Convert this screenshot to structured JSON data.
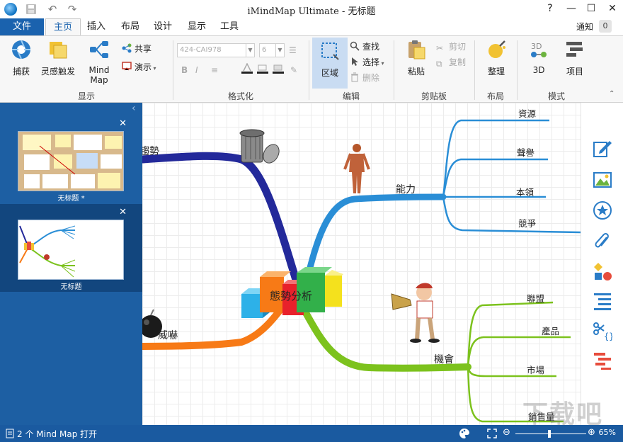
{
  "window": {
    "title": "iMindMap Ultimate - 无标题",
    "help": "?",
    "minimize": "—",
    "maximize": "☐",
    "close": "✕"
  },
  "tabs": {
    "file": "文件",
    "home": "主页",
    "insert": "插入",
    "layout": "布局",
    "design": "设计",
    "view": "显示",
    "tools": "工具",
    "notify": "通知",
    "notify_count": "0"
  },
  "ribbon": {
    "capture": "捕获",
    "inspire": "灵感触发",
    "mindmap": "Mind Map",
    "share": "共享",
    "present": "演示",
    "group_view": "显示",
    "font_combo": "424-CAI978",
    "size_combo": "6",
    "bold": "B",
    "italic": "I",
    "group_format": "格式化",
    "region": "区域",
    "find": "查找",
    "select": "选择",
    "delete": "删除",
    "group_edit": "编辑",
    "paste": "粘贴",
    "cut": "剪切",
    "copy": "复制",
    "group_clipboard": "剪贴板",
    "tidy": "整理",
    "group_layout": "布局",
    "three_d": "3D",
    "project": "项目",
    "group_mode": "模式"
  },
  "sidebar": {
    "maps": [
      {
        "label": "无标题 *"
      },
      {
        "label": "无标题"
      }
    ]
  },
  "mindmap": {
    "central": "態勢分析",
    "branches": {
      "top_left": "趨勢",
      "bottom_left": "威嚇",
      "right_top": "能力",
      "right_bottom": "機會"
    },
    "leaves_top": [
      "資源",
      "聲譽",
      "本領",
      "競爭"
    ],
    "leaves_bottom": [
      "聯盟",
      "產品",
      "市場",
      "銷售量"
    ],
    "colors": {
      "navy": "#23299a",
      "orange": "#f77a16",
      "blue": "#2a8ed6",
      "green": "#7cc21d"
    }
  },
  "righttools": [
    "pencil-icon",
    "image-icon",
    "star-icon",
    "paperclip-icon",
    "shapes-icon",
    "list-icon",
    "scissors-braces-icon",
    "gantt-icon"
  ],
  "status": {
    "open_count": "2 个 Mind Map 打开",
    "zoom": "65%"
  },
  "watermark": "下载吧"
}
